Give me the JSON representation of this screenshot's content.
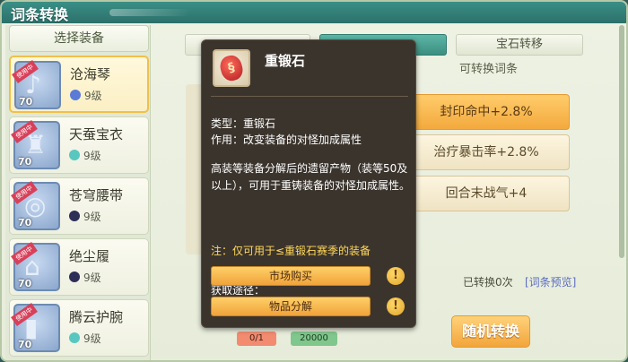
{
  "window": {
    "title": "词条转换"
  },
  "left": {
    "header": "选择装备",
    "equipment": [
      {
        "name": "沧海琴",
        "level": "9级",
        "badge": "使用中",
        "item_level": "70",
        "gem_color": "#5a7bd6",
        "icon": "lute-icon"
      },
      {
        "name": "天蚕宝衣",
        "level": "9级",
        "badge": "使用中",
        "item_level": "70",
        "gem_color": "#58c7c0",
        "icon": "armor-icon"
      },
      {
        "name": "苍穹腰带",
        "level": "9级",
        "badge": "使用中",
        "item_level": "70",
        "gem_color": "#2d2f57",
        "icon": "belt-icon"
      },
      {
        "name": "绝尘履",
        "level": "9级",
        "badge": "使用中",
        "item_level": "70",
        "gem_color": "#2d2f57",
        "icon": "boots-icon"
      },
      {
        "name": "腾云护腕",
        "level": "9级",
        "badge": "使用中",
        "item_level": "70",
        "gem_color": "#58c7c0",
        "icon": "bracer-icon"
      }
    ]
  },
  "tabs": {
    "gem_transfer": "宝石转移"
  },
  "right": {
    "section_title": "可转换词条",
    "attributes": [
      "封印命中+2.8%",
      "治疗暴击率+2.8%",
      "回合末战气+4"
    ],
    "changed_text": "已转换0次",
    "preview_link": "[词条预览]",
    "random_button": "随机转换",
    "cost_qty": "0/1",
    "cost_money": "20000"
  },
  "tooltip": {
    "name": "重锻石",
    "type_line": "类型：重锻石",
    "effect_line": "作用：改变装备的对怪加成属性",
    "description": "高装等装备分解后的遗留产物（装等50及以上），可用于重铸装备的对怪加成属性。",
    "note": "注：仅可用于≤重锻石赛季的装备",
    "source_label": "获取途径：",
    "source_buttons": [
      "市场购买",
      "物品分解"
    ]
  },
  "colors": {
    "accent": "#3b8e80",
    "highlight": "#f3a93d",
    "tooltip_bg": "#3b342d"
  }
}
